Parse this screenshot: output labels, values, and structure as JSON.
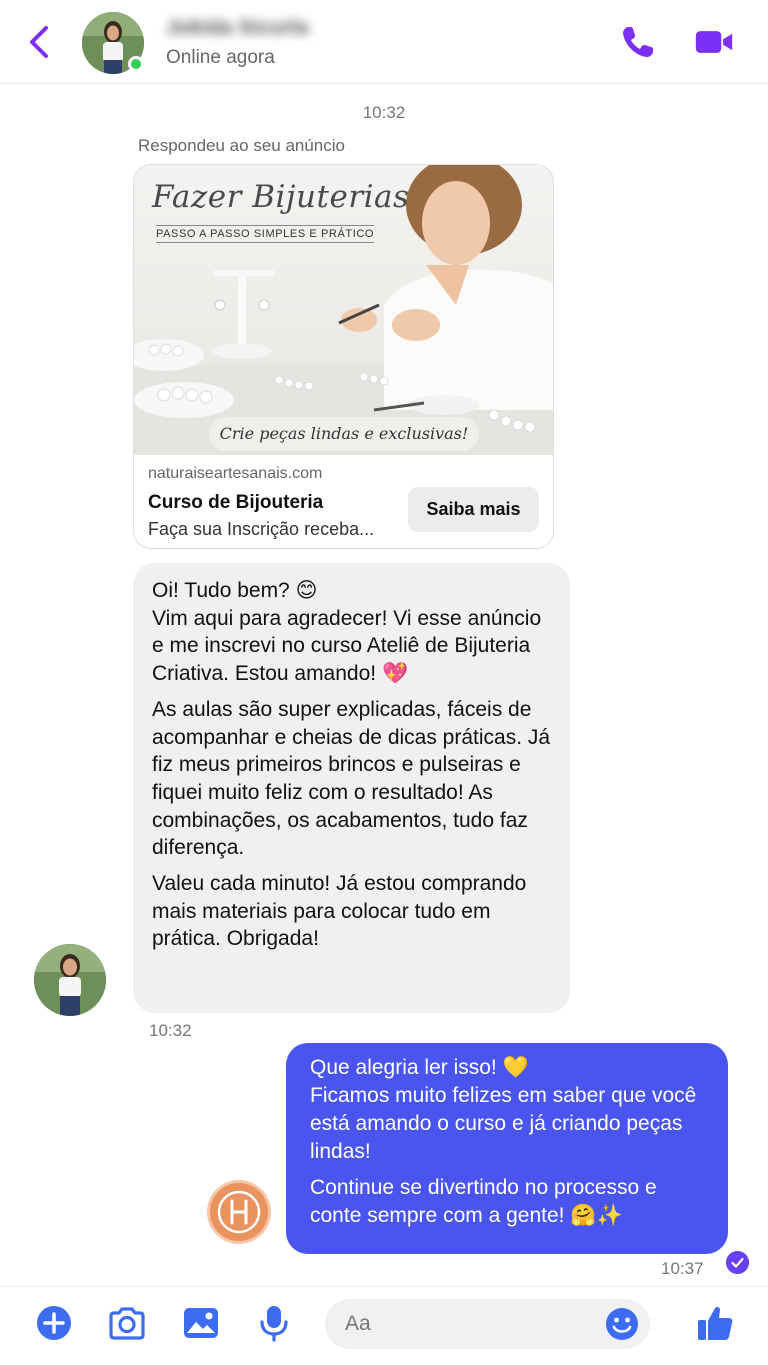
{
  "header": {
    "contact_name": "Jokida Sicurla",
    "status": "Online agora"
  },
  "chat": {
    "timestamp_top": "10:32",
    "replied_note": "Respondeu ao seu anúncio",
    "ad": {
      "image_title": "Fazer Bijuterias",
      "image_subtitle": "PASSO A PASSO SIMPLES E PRÁTICO",
      "image_tagline": "Crie peças lindas e exclusivas!",
      "domain": "naturaiseartesanais.com",
      "course_title": "Curso de Bijouteria",
      "description": "Faça sua Inscrição receba...",
      "cta_label": "Saiba mais"
    },
    "incoming": {
      "p1": "Oi! Tudo bem? 😊",
      "p2": "Vim aqui para agradecer! Vi esse anúncio e me inscrevi no curso Ateliê de Bijuteria Criativa. Estou amando! 💖",
      "p3": "As aulas são super explicadas, fáceis de acompanhar e cheias de dicas práticas. Já fiz meus primeiros brincos e pulseiras e fiquei muito feliz com o resultado! As combinações, os acabamentos, tudo faz diferença.",
      "p4": "Valeu cada minuto! Já estou comprando mais materiais para colocar tudo em prática. Obrigada!",
      "time": "10:32"
    },
    "outgoing": {
      "p1": "Que alegria ler isso! 💛",
      "p2": "Ficamos muito felizes em saber que você está amando o curso e já criando peças lindas!",
      "p3": "Continue se divertindo no processo e conte sempre com a gente! 🤗✨",
      "time": "10:37"
    }
  },
  "composer": {
    "placeholder": "Aa"
  },
  "colors": {
    "accent": "#7b2ff7",
    "outgoing_bubble": "#4a55f0",
    "incoming_bubble": "#f0f0f0",
    "composer_icon": "#3d6cf0",
    "online": "#31d156"
  }
}
